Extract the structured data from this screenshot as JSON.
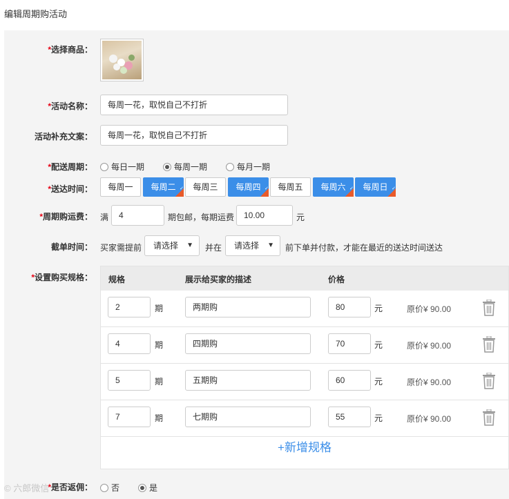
{
  "page": {
    "title": "编辑周期购活动"
  },
  "form": {
    "product": {
      "label": "选择商品：",
      "required": "*"
    },
    "name": {
      "label": "活动名称：",
      "required": "*",
      "value": "每周一花，取悦自己不打折"
    },
    "extra_copy": {
      "label": "活动补充文案：",
      "value": "每周一花，取悦自己不打折"
    },
    "cycle": {
      "label": "配送周期：",
      "required": "*",
      "options": [
        "每日一期",
        "每周一期",
        "每月一期"
      ],
      "selected": "每周一期"
    },
    "delivery_days": {
      "label": "送达时间：",
      "required": "*",
      "days": [
        "每周一",
        "每周二",
        "每周三",
        "每周四",
        "每周五",
        "每周六",
        "每周日"
      ],
      "selected": [
        "每周二",
        "每周四",
        "每周六",
        "每周日"
      ]
    },
    "shipping": {
      "label": "周期购运费：",
      "required": "*",
      "prefix": "满",
      "threshold": "4",
      "middle": "期包邮，每期运费",
      "fee": "10.00",
      "suffix": "元"
    },
    "cutoff": {
      "label": "截单时间：",
      "prefix": "买家需提前",
      "select1": "请选择",
      "middle": "并在",
      "select2": "请选择",
      "suffix": "前下单并付款，才能在最近的送达时间送达"
    },
    "specs": {
      "label": "设置购买规格：",
      "required": "*",
      "headers": {
        "spec": "规格",
        "desc": "展示给买家的描述",
        "price": "价格"
      },
      "period_unit": "期",
      "price_unit": "元",
      "rows": [
        {
          "periods": "2",
          "desc": "两期购",
          "price": "80",
          "original": "原价¥ 90.00"
        },
        {
          "periods": "4",
          "desc": "四期购",
          "price": "70",
          "original": "原价¥ 90.00"
        },
        {
          "periods": "5",
          "desc": "五期购",
          "price": "60",
          "original": "原价¥ 90.00"
        },
        {
          "periods": "7",
          "desc": "七期购",
          "price": "55",
          "original": "原价¥ 90.00"
        }
      ],
      "add_label": "+新增规格"
    },
    "rebate": {
      "label": "是否返佣：",
      "required": "*",
      "options": [
        "否",
        "是"
      ],
      "selected": "是"
    }
  },
  "watermark": "© 六郎微信",
  "colors": {
    "accent": "#3b8ee8",
    "required": "#e60012",
    "check": "#e85a2a"
  }
}
